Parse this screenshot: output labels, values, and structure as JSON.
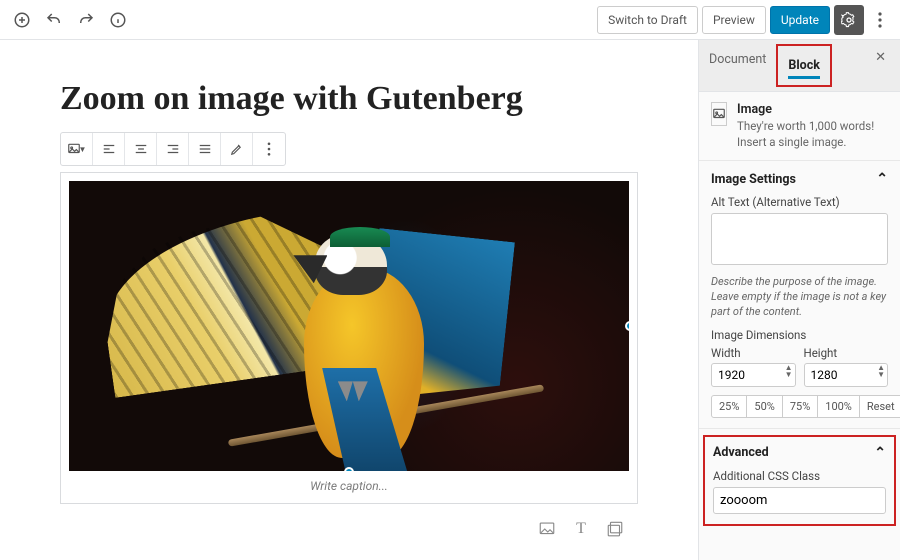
{
  "topbar": {
    "switch_to_draft": "Switch to Draft",
    "preview": "Preview",
    "update": "Update"
  },
  "post": {
    "title": "Zoom on image with Gutenberg",
    "caption_placeholder": "Write caption..."
  },
  "sidebar": {
    "tabs": {
      "document": "Document",
      "block": "Block"
    },
    "block": {
      "name": "Image",
      "desc": "They're worth 1,000 words! Insert a single image."
    },
    "image_settings": {
      "title": "Image Settings",
      "alt_label": "Alt Text (Alternative Text)",
      "alt_value": "",
      "hint": "Describe the purpose of the image. Leave empty if the image is not a key part of the content.",
      "dimensions_label": "Image Dimensions",
      "width_label": "Width",
      "height_label": "Height",
      "width": "1920",
      "height": "1280",
      "presets": [
        "25%",
        "50%",
        "75%",
        "100%"
      ],
      "reset": "Reset"
    },
    "advanced": {
      "title": "Advanced",
      "css_label": "Additional CSS Class",
      "css_value": "zoooom"
    }
  },
  "colors": {
    "primary": "#0085ba",
    "highlight": "#c22"
  }
}
